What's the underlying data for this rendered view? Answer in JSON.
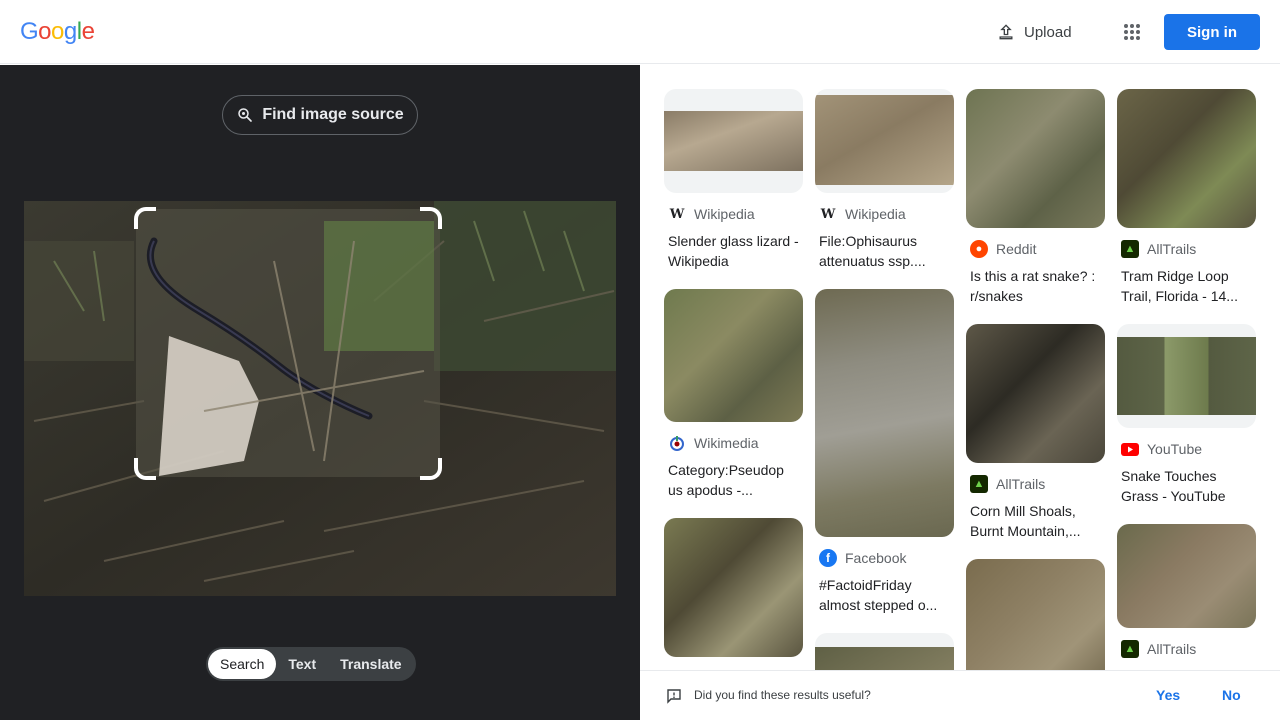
{
  "header": {
    "logo_letters": [
      {
        "ch": "G",
        "color": "#4285F4"
      },
      {
        "ch": "o",
        "color": "#EA4335"
      },
      {
        "ch": "o",
        "color": "#FBBC05"
      },
      {
        "ch": "g",
        "color": "#4285F4"
      },
      {
        "ch": "l",
        "color": "#34A853"
      },
      {
        "ch": "e",
        "color": "#EA4335"
      }
    ],
    "upload_label": "Upload",
    "apps_icon": "apps-grid-icon",
    "signin_label": "Sign in"
  },
  "left": {
    "find_source_label": "Find image source",
    "tabs": [
      {
        "label": "Search",
        "active": true
      },
      {
        "label": "Text",
        "active": false
      },
      {
        "label": "Translate",
        "active": false
      }
    ]
  },
  "results": {
    "columns": [
      [
        {
          "source": "Wikipedia",
          "icon": "W",
          "title": "Slender glass lizard - Wikipedia"
        },
        {
          "source": "Wikimedia",
          "icon": "wikimedia",
          "title": "Category:Pseudop us apodus -..."
        },
        {
          "source": "",
          "icon": "",
          "title": ""
        }
      ],
      [
        {
          "source": "Wikipedia",
          "icon": "W",
          "title": "File:Ophisaurus attenuatus ssp...."
        },
        {
          "source": "Facebook",
          "icon": "facebook",
          "title": "#FactoidFriday almost stepped o..."
        },
        {
          "source": "",
          "icon": "",
          "title": ""
        }
      ],
      [
        {
          "source": "Reddit",
          "icon": "reddit",
          "title": "Is this a rat snake? : r/snakes"
        },
        {
          "source": "AllTrails",
          "icon": "alltrails",
          "title": "Corn Mill Shoals, Burnt Mountain,..."
        },
        {
          "source": "",
          "icon": "",
          "title": ""
        }
      ],
      [
        {
          "source": "AllTrails",
          "icon": "alltrails",
          "title": "Tram Ridge Loop Trail, Florida - 14..."
        },
        {
          "source": "YouTube",
          "icon": "youtube",
          "title": "Snake Touches Grass - YouTube"
        },
        {
          "source": "AllTrails",
          "icon": "alltrails",
          "title": ""
        }
      ]
    ]
  },
  "feedback": {
    "question": "Did you find these results useful?",
    "yes": "Yes",
    "no": "No"
  },
  "colors": {
    "accent": "#1a73e8",
    "left_bg": "#202124"
  }
}
